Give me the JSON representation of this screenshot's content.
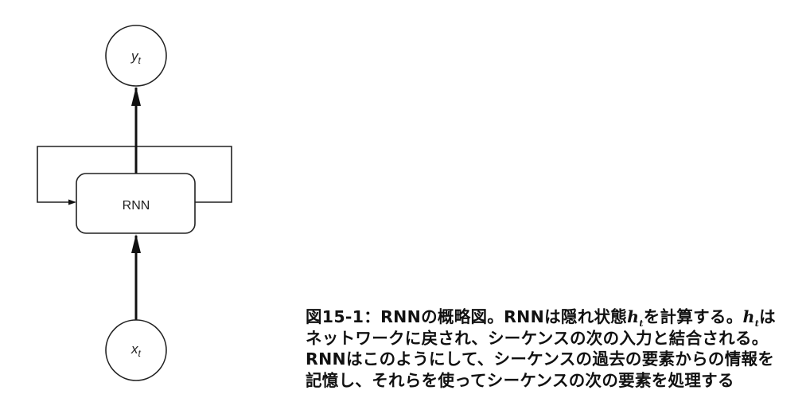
{
  "diagram": {
    "output_node": {
      "label": "y",
      "subscript": "t"
    },
    "rnn_box": {
      "label": "RNN"
    },
    "input_node": {
      "label": "x",
      "subscript": "t"
    }
  },
  "caption": {
    "line1_a": "図15-1：RNNの概略図。RNNは隠れ状態",
    "h_var": "h",
    "h_sub": "t",
    "line1_b": "を計算する。",
    "line1_c": "は",
    "line2": "ネットワークに戻され、シーケンスの次の入力と結合される。",
    "line3": "RNNはこのようにして、シーケンスの過去の要素からの情報を",
    "line4": "記憶し、それらを使ってシーケンスの次の要素を処理する"
  }
}
